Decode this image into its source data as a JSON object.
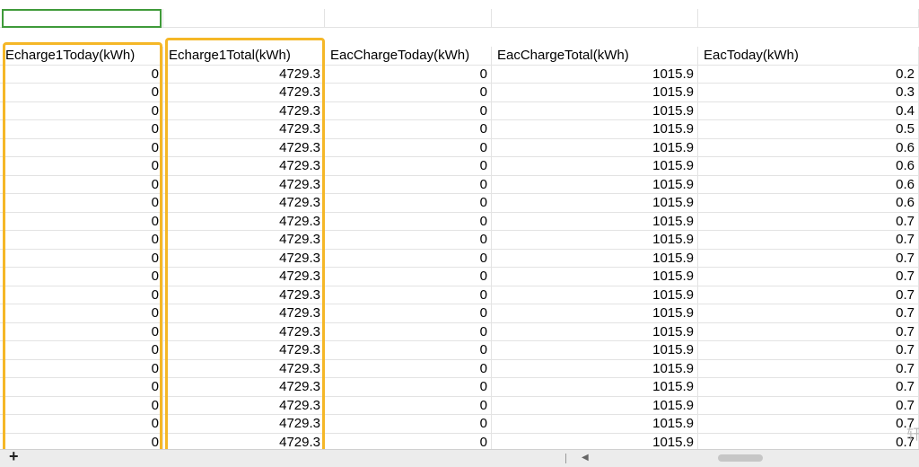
{
  "sheet": {
    "headers": [
      "Echarge1Today(kWh)",
      "Echarge1Total(kWh)",
      "EacChargeToday(kWh)",
      "EacChargeTotal(kWh)",
      "EacToday(kWh)"
    ],
    "rows": [
      [
        "0",
        "4729.3",
        "0",
        "1015.9",
        "0.2"
      ],
      [
        "0",
        "4729.3",
        "0",
        "1015.9",
        "0.3"
      ],
      [
        "0",
        "4729.3",
        "0",
        "1015.9",
        "0.4"
      ],
      [
        "0",
        "4729.3",
        "0",
        "1015.9",
        "0.5"
      ],
      [
        "0",
        "4729.3",
        "0",
        "1015.9",
        "0.6"
      ],
      [
        "0",
        "4729.3",
        "0",
        "1015.9",
        "0.6"
      ],
      [
        "0",
        "4729.3",
        "0",
        "1015.9",
        "0.6"
      ],
      [
        "0",
        "4729.3",
        "0",
        "1015.9",
        "0.6"
      ],
      [
        "0",
        "4729.3",
        "0",
        "1015.9",
        "0.7"
      ],
      [
        "0",
        "4729.3",
        "0",
        "1015.9",
        "0.7"
      ],
      [
        "0",
        "4729.3",
        "0",
        "1015.9",
        "0.7"
      ],
      [
        "0",
        "4729.3",
        "0",
        "1015.9",
        "0.7"
      ],
      [
        "0",
        "4729.3",
        "0",
        "1015.9",
        "0.7"
      ],
      [
        "0",
        "4729.3",
        "0",
        "1015.9",
        "0.7"
      ],
      [
        "0",
        "4729.3",
        "0",
        "1015.9",
        "0.7"
      ],
      [
        "0",
        "4729.3",
        "0",
        "1015.9",
        "0.7"
      ],
      [
        "0",
        "4729.3",
        "0",
        "1015.9",
        "0.7"
      ],
      [
        "0",
        "4729.3",
        "0",
        "1015.9",
        "0.7"
      ],
      [
        "0",
        "4729.3",
        "0",
        "1015.9",
        "0.7"
      ],
      [
        "0",
        "4729.3",
        "0",
        "1015.9",
        "0.7"
      ],
      [
        "0",
        "4729.3",
        "0",
        "1015.9",
        "0.7"
      ]
    ]
  },
  "statusbar": {
    "add_label": "+"
  },
  "colors": {
    "highlight": "#f5b727",
    "selection": "#3f9a3a",
    "gridline": "#e3e3e3"
  },
  "icons": {
    "add_sheet": "plus-icon",
    "scroll_left": "arrow-left-icon"
  }
}
